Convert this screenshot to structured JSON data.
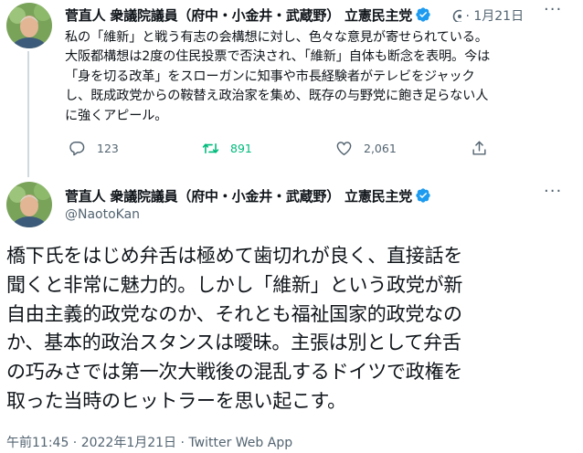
{
  "thread_tweet": {
    "author_name": "菅直人 衆議院議員（府中・小金井・武蔵野） 立憲民主党",
    "separator": "·",
    "date": "1月21日",
    "more_label": "···",
    "body_lines": [
      "私の「維新」と戦う有志の会構想に対し、色々な意見が寄せられている。",
      "大阪都構想は2度の住民投票で否決され、「維新」自体も断念を表明。今は",
      "「身を切る改革」をスローガンに知事や市長経験者がテレビをジャック",
      "し、既成政党からの鞍替え政治家を集め、既存の与野党に飽き足らない人",
      "に強くアピール。"
    ],
    "actions": {
      "reply_count": "123",
      "retweet_count": "891",
      "like_count": "2,061"
    }
  },
  "main_tweet": {
    "author_name": "菅直人 衆議院議員（府中・小金井・武蔵野） 立憲民主党",
    "handle": "@NaotoKan",
    "more_label": "···",
    "body_lines": [
      "橋下氏をはじめ弁舌は極めて歯切れが良く、直接話を",
      "聞くと非常に魅力的。しかし「維新」という政党が新",
      "自由主義的政党なのか、それとも福祉国家的政党なの",
      "か、基本的政治スタンスは曖昧。主張は別として弁舌",
      "の巧みさでは第一次大戦後の混乱するドイツで政権を",
      "取った当時のヒットラーを思い起こす。"
    ],
    "footer": "午前11:45 · 2022年1月21日 · Twitter Web App"
  },
  "colors": {
    "verified": "#1d9bf0",
    "retweet_active": "#00ba7c",
    "muted": "#536471",
    "text": "#0f1419"
  },
  "icons": {
    "verified": "verified-badge-icon",
    "reply": "reply-icon",
    "retweet": "retweet-icon",
    "like": "heart-icon",
    "share": "share-icon",
    "more": "more-dots-icon"
  }
}
